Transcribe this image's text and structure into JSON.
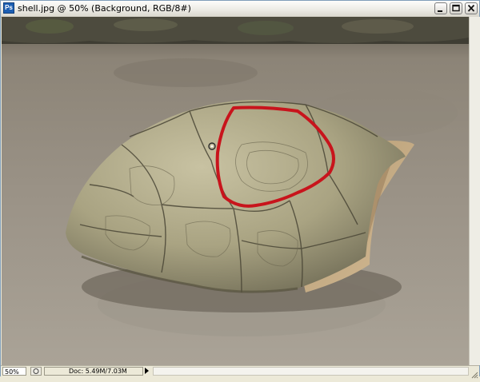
{
  "window": {
    "title": "shell.jpg @ 50% (Background, RGB/8#)",
    "app_icon": "photoshop-document-icon",
    "buttons": [
      "minimize-icon",
      "maximize-icon",
      "close-icon"
    ]
  },
  "status_bar": {
    "zoom": "50%",
    "doc_info": "Doc: 5.49M/7.03M"
  },
  "colors": {
    "selection_outline": "#c8141c",
    "title_bar": "#ecebe5",
    "window_frame": "#7f9db9"
  }
}
